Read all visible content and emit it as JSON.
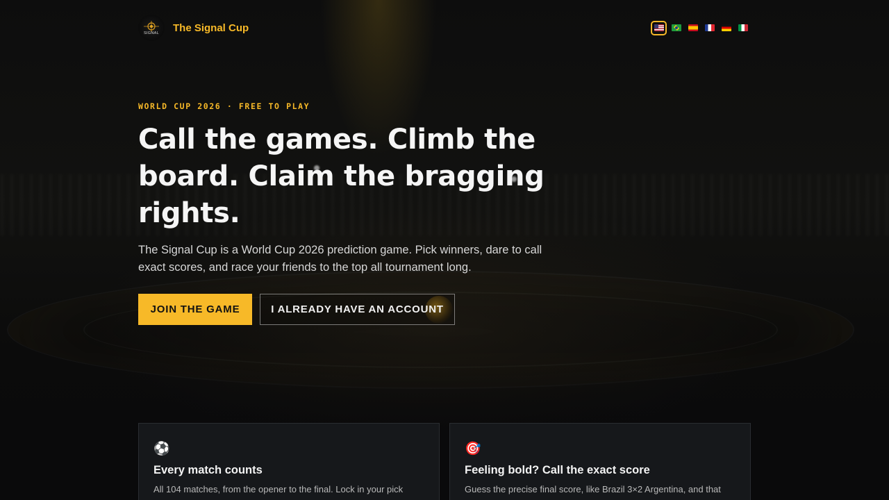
{
  "brand": {
    "logo_text": "SIGNAL",
    "name": "The Signal Cup"
  },
  "languages": [
    {
      "code": "en",
      "icon": "us-flag-icon",
      "active": true
    },
    {
      "code": "pt",
      "icon": "brazil-flag-icon",
      "active": false
    },
    {
      "code": "es",
      "icon": "spain-flag-icon",
      "active": false
    },
    {
      "code": "fr",
      "icon": "france-flag-icon",
      "active": false
    },
    {
      "code": "de",
      "icon": "germany-flag-icon",
      "active": false
    },
    {
      "code": "it",
      "icon": "italy-flag-icon",
      "active": false
    }
  ],
  "hero": {
    "eyebrow": "WORLD CUP 2026 · FREE TO PLAY",
    "headline": "Call the games. Climb the board. Claim the bragging rights.",
    "lead": "The Signal Cup is a World Cup 2026 prediction game. Pick winners, dare to call exact scores, and race your friends to the top all tournament long.",
    "primary_cta": "JOIN THE GAME",
    "secondary_cta": "I ALREADY HAVE AN ACCOUNT"
  },
  "features": [
    {
      "icon": "soccer-ball-icon",
      "glyph": "⚽",
      "title": "Every match counts",
      "body": "All 104 matches, from the opener to the final. Lock in your pick"
    },
    {
      "icon": "target-icon",
      "glyph": "🎯",
      "title": "Feeling bold? Call the exact score",
      "body": "Guess the precise final score, like Brazil 3×2 Argentina, and that"
    }
  ],
  "colors": {
    "accent": "#f7b928",
    "background": "#0a0a0b",
    "card": "#16181b"
  }
}
